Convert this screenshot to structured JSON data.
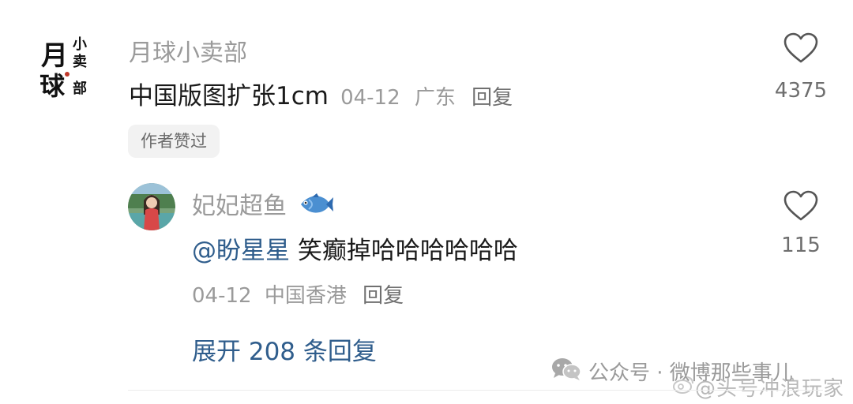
{
  "comment": {
    "username": "月球小卖部",
    "text": "中国版图扩张1cm",
    "date": "04-12",
    "location": "广东",
    "reply_label": "回复",
    "like_count": "4375",
    "badge": "作者赞过",
    "avatar_logo_text": [
      "月",
      "小",
      "卖",
      "球",
      "部"
    ]
  },
  "reply": {
    "username": "妃妃超鱼",
    "username_emoji": "fish-emoji",
    "mention": "@盼星星",
    "text": " 笑癫掉哈哈哈哈哈哈",
    "date": "04-12",
    "location": "中国香港",
    "reply_label": "回复",
    "like_count": "115"
  },
  "expand_label": "展开 208 条回复",
  "watermark": {
    "line1": "公众号 · 微博那些事儿",
    "line2": "@头号冲浪玩家"
  },
  "colors": {
    "link": "#2f5d8c",
    "muted": "#9a9a9a",
    "text": "#1a1a1a"
  }
}
